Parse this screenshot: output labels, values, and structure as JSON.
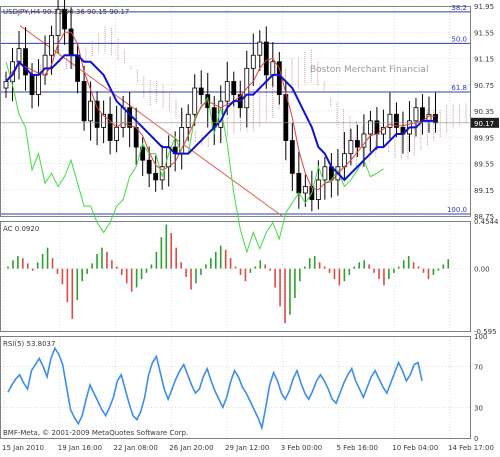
{
  "colors": {
    "background": "#ffffff",
    "frame": "#808080",
    "grid": "#c9c9c9",
    "text": "#3a3a3a",
    "watermark": "#9a9aa6",
    "candles": "#000000",
    "tenkan_sen": "#e04040",
    "kijun_sen": "#1010d0",
    "chikou_span": "#40dd40",
    "kumo": "#c89aa8",
    "fib_line": "#2c3cb8",
    "trendline": "#e06050",
    "ac_up": "#2ca02c",
    "ac_down": "#e04848",
    "rsi_line": "#3c8ee8",
    "last_price_bg": "#202020",
    "last_price_text": "#ffffff"
  },
  "watermark": "Boston Merchant Financial",
  "footer": "BMF-Meta, © 2001-2009 MetaQuotes Software Corp.",
  "x_axis": {
    "labels": [
      "15 Jan 2010",
      "19 Jan 16:00",
      "22 Jan 08:00",
      "26 Jan 20:00",
      "29 Jan 12:00",
      "3 Feb 00:00",
      "5 Feb 16:00",
      "10 Feb 04:00",
      "14 Feb 17:00"
    ]
  },
  "chart_data": [
    {
      "type": "candlestick",
      "title": "USDJPY,H4  90.32 90.36 90.15 90.17",
      "ylim": [
        88.75,
        91.95
      ],
      "y_ticks": [
        91.95,
        91.55,
        91.15,
        90.75,
        90.35,
        89.95,
        89.55,
        89.15,
        88.75
      ],
      "last_price": 90.17,
      "last_price_label": "90.17",
      "fibonacci_levels": [
        {
          "label": "38.2",
          "value": 91.86
        },
        {
          "label": "50.0",
          "value": 91.38
        },
        {
          "label": "61.8",
          "value": 90.64
        },
        {
          "label": "100.0",
          "value": 88.78
        }
      ],
      "indicators": [
        "Ichimoku Kinko Hyo",
        "Fibonacci retracement",
        "Trendline"
      ],
      "close_path": [
        90.8,
        91.1,
        91.3,
        90.9,
        90.6,
        90.9,
        91.2,
        91.5,
        91.9,
        91.6,
        91.2,
        90.8,
        90.2,
        90.5,
        90.1,
        90.3,
        89.9,
        90.1,
        90.4,
        90.1,
        89.8,
        89.6,
        89.4,
        89.3,
        89.5,
        89.8,
        89.7,
        90.1,
        90.3,
        90.7,
        90.6,
        90.4,
        90.1,
        90.5,
        90.8,
        90.6,
        90.4,
        91.0,
        91.2,
        91.4,
        90.9,
        91.1,
        90.6,
        89.9,
        89.4,
        89.1,
        89.2,
        89.0,
        89.3,
        89.5,
        89.3,
        89.5,
        89.7,
        89.9,
        89.8,
        90.0,
        90.2,
        90.0,
        90.1,
        90.3,
        90.1,
        90.0,
        90.2,
        90.4,
        90.2,
        90.3,
        90.17
      ]
    },
    {
      "type": "bar",
      "title": "AC 0.0920",
      "ylim": [
        -0.595,
        0.4544
      ],
      "y_ticks_labels": [
        "0.4544",
        "0.00",
        "-0.595"
      ],
      "values": [
        0.02,
        0.08,
        0.12,
        0.1,
        0.05,
        -0.02,
        0.06,
        0.14,
        0.2,
        0.1,
        -0.05,
        -0.15,
        -0.32,
        -0.48,
        -0.3,
        -0.12,
        -0.05,
        0.05,
        0.14,
        0.2,
        0.16,
        0.08,
        0.02,
        -0.06,
        -0.14,
        -0.22,
        -0.18,
        -0.1,
        -0.04,
        0.04,
        0.16,
        0.3,
        0.42,
        0.34,
        0.2,
        0.06,
        -0.08,
        -0.2,
        -0.14,
        -0.06,
        0.04,
        0.1,
        0.16,
        0.22,
        0.18,
        0.1,
        0.02,
        -0.06,
        -0.12,
        -0.04,
        0.02,
        0.08,
        0.04,
        -0.02,
        -0.18,
        -0.36,
        -0.52,
        -0.44,
        -0.28,
        -0.12,
        0.02,
        0.1,
        0.12,
        0.06,
        0.02,
        -0.04,
        -0.1,
        -0.16,
        -0.12,
        -0.06,
        0.02,
        0.06,
        0.08,
        0.04,
        -0.04,
        -0.1,
        -0.16,
        -0.1,
        -0.04,
        0.02,
        0.08,
        0.12,
        0.06,
        0.02,
        -0.04,
        -0.1,
        -0.06,
        -0.02,
        0.04,
        0.09
      ]
    },
    {
      "type": "line",
      "title": "RSI(5) 53.8037",
      "ylim": [
        0,
        100
      ],
      "y_ticks_labels": [
        "100",
        "70",
        "30",
        "0"
      ],
      "values": [
        45,
        52,
        58,
        62,
        54,
        48,
        66,
        72,
        78,
        70,
        60,
        78,
        88,
        82,
        72,
        50,
        28,
        20,
        14,
        22,
        38,
        52,
        44,
        36,
        28,
        22,
        30,
        40,
        56,
        62,
        48,
        34,
        22,
        18,
        26,
        40,
        62,
        74,
        80,
        64,
        48,
        38,
        48,
        58,
        66,
        72,
        62,
        52,
        44,
        48,
        60,
        68,
        56,
        46,
        38,
        30,
        40,
        55,
        66,
        60,
        50,
        44,
        36,
        28,
        20,
        10,
        30,
        52,
        64,
        56,
        44,
        38,
        46,
        58,
        66,
        54,
        44,
        38,
        46,
        56,
        62,
        56,
        48,
        38,
        34,
        44,
        54,
        62,
        68,
        56,
        48,
        40,
        50,
        60,
        66,
        58,
        50,
        44,
        54,
        64,
        74,
        66,
        56,
        62,
        72,
        74,
        56
      ]
    }
  ]
}
